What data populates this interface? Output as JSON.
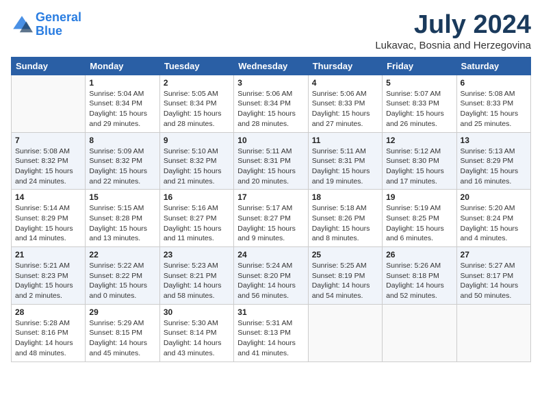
{
  "app": {
    "name_general": "General",
    "name_blue": "Blue",
    "title": "July 2024",
    "location": "Lukavac, Bosnia and Herzegovina"
  },
  "days_of_week": [
    "Sunday",
    "Monday",
    "Tuesday",
    "Wednesday",
    "Thursday",
    "Friday",
    "Saturday"
  ],
  "weeks": [
    [
      {
        "day": "",
        "sunrise": "",
        "sunset": "",
        "daylight": ""
      },
      {
        "day": "1",
        "sunrise": "5:04 AM",
        "sunset": "8:34 PM",
        "daylight": "15 hours and 29 minutes."
      },
      {
        "day": "2",
        "sunrise": "5:05 AM",
        "sunset": "8:34 PM",
        "daylight": "15 hours and 28 minutes."
      },
      {
        "day": "3",
        "sunrise": "5:06 AM",
        "sunset": "8:34 PM",
        "daylight": "15 hours and 28 minutes."
      },
      {
        "day": "4",
        "sunrise": "5:06 AM",
        "sunset": "8:33 PM",
        "daylight": "15 hours and 27 minutes."
      },
      {
        "day": "5",
        "sunrise": "5:07 AM",
        "sunset": "8:33 PM",
        "daylight": "15 hours and 26 minutes."
      },
      {
        "day": "6",
        "sunrise": "5:08 AM",
        "sunset": "8:33 PM",
        "daylight": "15 hours and 25 minutes."
      }
    ],
    [
      {
        "day": "7",
        "sunrise": "5:08 AM",
        "sunset": "8:32 PM",
        "daylight": "15 hours and 24 minutes."
      },
      {
        "day": "8",
        "sunrise": "5:09 AM",
        "sunset": "8:32 PM",
        "daylight": "15 hours and 22 minutes."
      },
      {
        "day": "9",
        "sunrise": "5:10 AM",
        "sunset": "8:32 PM",
        "daylight": "15 hours and 21 minutes."
      },
      {
        "day": "10",
        "sunrise": "5:11 AM",
        "sunset": "8:31 PM",
        "daylight": "15 hours and 20 minutes."
      },
      {
        "day": "11",
        "sunrise": "5:11 AM",
        "sunset": "8:31 PM",
        "daylight": "15 hours and 19 minutes."
      },
      {
        "day": "12",
        "sunrise": "5:12 AM",
        "sunset": "8:30 PM",
        "daylight": "15 hours and 17 minutes."
      },
      {
        "day": "13",
        "sunrise": "5:13 AM",
        "sunset": "8:29 PM",
        "daylight": "15 hours and 16 minutes."
      }
    ],
    [
      {
        "day": "14",
        "sunrise": "5:14 AM",
        "sunset": "8:29 PM",
        "daylight": "15 hours and 14 minutes."
      },
      {
        "day": "15",
        "sunrise": "5:15 AM",
        "sunset": "8:28 PM",
        "daylight": "15 hours and 13 minutes."
      },
      {
        "day": "16",
        "sunrise": "5:16 AM",
        "sunset": "8:27 PM",
        "daylight": "15 hours and 11 minutes."
      },
      {
        "day": "17",
        "sunrise": "5:17 AM",
        "sunset": "8:27 PM",
        "daylight": "15 hours and 9 minutes."
      },
      {
        "day": "18",
        "sunrise": "5:18 AM",
        "sunset": "8:26 PM",
        "daylight": "15 hours and 8 minutes."
      },
      {
        "day": "19",
        "sunrise": "5:19 AM",
        "sunset": "8:25 PM",
        "daylight": "15 hours and 6 minutes."
      },
      {
        "day": "20",
        "sunrise": "5:20 AM",
        "sunset": "8:24 PM",
        "daylight": "15 hours and 4 minutes."
      }
    ],
    [
      {
        "day": "21",
        "sunrise": "5:21 AM",
        "sunset": "8:23 PM",
        "daylight": "15 hours and 2 minutes."
      },
      {
        "day": "22",
        "sunrise": "5:22 AM",
        "sunset": "8:22 PM",
        "daylight": "15 hours and 0 minutes."
      },
      {
        "day": "23",
        "sunrise": "5:23 AM",
        "sunset": "8:21 PM",
        "daylight": "14 hours and 58 minutes."
      },
      {
        "day": "24",
        "sunrise": "5:24 AM",
        "sunset": "8:20 PM",
        "daylight": "14 hours and 56 minutes."
      },
      {
        "day": "25",
        "sunrise": "5:25 AM",
        "sunset": "8:19 PM",
        "daylight": "14 hours and 54 minutes."
      },
      {
        "day": "26",
        "sunrise": "5:26 AM",
        "sunset": "8:18 PM",
        "daylight": "14 hours and 52 minutes."
      },
      {
        "day": "27",
        "sunrise": "5:27 AM",
        "sunset": "8:17 PM",
        "daylight": "14 hours and 50 minutes."
      }
    ],
    [
      {
        "day": "28",
        "sunrise": "5:28 AM",
        "sunset": "8:16 PM",
        "daylight": "14 hours and 48 minutes."
      },
      {
        "day": "29",
        "sunrise": "5:29 AM",
        "sunset": "8:15 PM",
        "daylight": "14 hours and 45 minutes."
      },
      {
        "day": "30",
        "sunrise": "5:30 AM",
        "sunset": "8:14 PM",
        "daylight": "14 hours and 43 minutes."
      },
      {
        "day": "31",
        "sunrise": "5:31 AM",
        "sunset": "8:13 PM",
        "daylight": "14 hours and 41 minutes."
      },
      {
        "day": "",
        "sunrise": "",
        "sunset": "",
        "daylight": ""
      },
      {
        "day": "",
        "sunrise": "",
        "sunset": "",
        "daylight": ""
      },
      {
        "day": "",
        "sunrise": "",
        "sunset": "",
        "daylight": ""
      }
    ]
  ]
}
